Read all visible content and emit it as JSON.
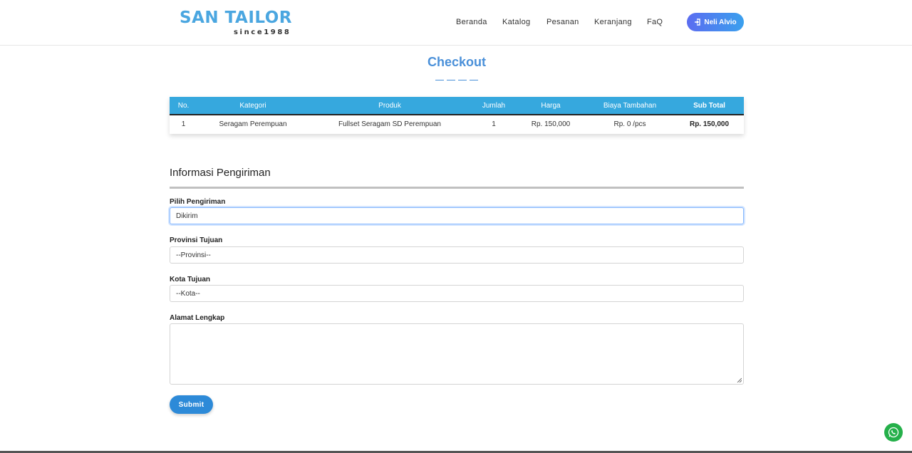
{
  "brand": {
    "name": "SAN TAILOR",
    "tagline": "since1988"
  },
  "nav": {
    "items": [
      "Beranda",
      "Katalog",
      "Pesanan",
      "Keranjang",
      "FaQ"
    ]
  },
  "user": {
    "name": "Neli Alvio"
  },
  "page": {
    "title": "Checkout"
  },
  "order_table": {
    "headers": [
      "No.",
      "Kategori",
      "Produk",
      "Jumlah",
      "Harga",
      "Biaya Tambahan",
      "Sub Total"
    ],
    "rows": [
      [
        "1",
        "Seragam Perempuan",
        "Fullset Seragam SD Perempuan",
        "1",
        "Rp. 150,000",
        "Rp. 0 /pcs",
        "Rp. 150,000"
      ]
    ]
  },
  "shipping": {
    "section_title": "Informasi Pengiriman",
    "pilih_label": "Pilih Pengiriman",
    "pilih_value": "Dikirim",
    "provinsi_label": "Provinsi Tujuan",
    "provinsi_value": "--Provinsi--",
    "kota_label": "Kota Tujuan",
    "kota_value": "--Kota--",
    "alamat_label": "Alamat Lengkap",
    "alamat_value": ""
  },
  "actions": {
    "submit_label": "Submit"
  },
  "colors": {
    "accent": "#4a90d9",
    "table_header": "#36a8de",
    "submit": "#2d8ad8",
    "whatsapp": "#25b04a"
  },
  "icons": {
    "user_button": "sign-in-icon",
    "chat": "whatsapp-icon"
  }
}
